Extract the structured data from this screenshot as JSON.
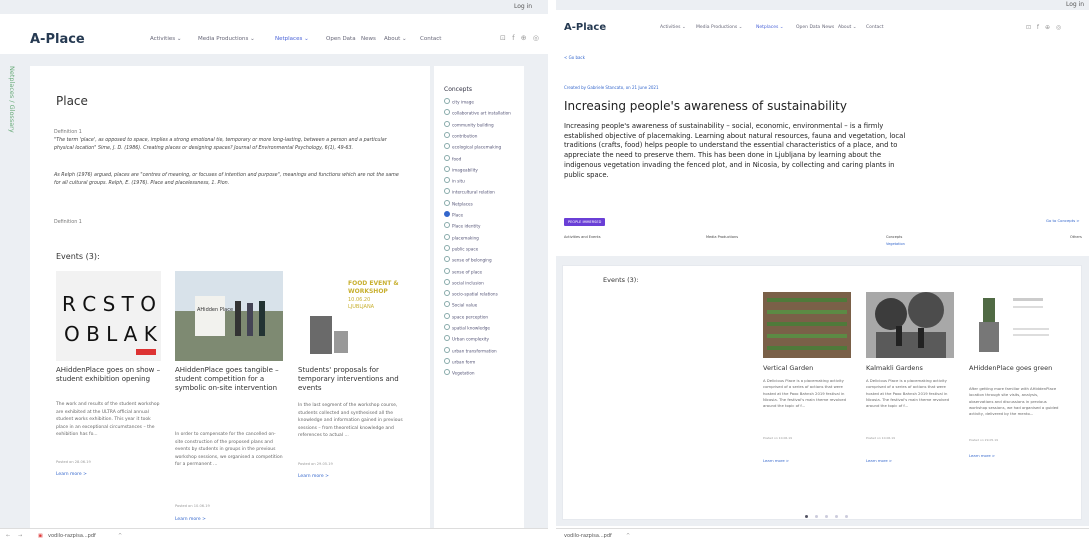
{
  "left": {
    "login": "Log in",
    "logo": "A-Place",
    "nav": [
      "Activities ⌄",
      "Media Productions ⌄",
      "Netplaces ⌄",
      "Open Data",
      "News",
      "About ⌄",
      "Contact"
    ],
    "nav_active_index": 2,
    "social": "⊡ f ⊕ ◎",
    "glossary_label": "Netplaces / Glossary",
    "page_title": "Place",
    "def1_label": "Definition 1",
    "def1_text": "\"The term 'place', as opposed to space, implies a strong emotional tie, temporary or more long-lasting, between a person and a particular physical location\" Sime, J. D. (1986). Creating places or designing spaces? Journal of Environmental Psychology, 6(1), 49-63.",
    "def2_text": "As Relph (1976) argued, places are \"centres of meaning, or focuses of intention and purpose\", meanings and functions which are not the same for all cultural groups. Relph, E. (1976). Place and placelessness, 1. Pion.",
    "def_footer": "Definition 1",
    "concepts_title": "Concepts",
    "concepts": [
      "city image",
      "collaborative art installation",
      "community building",
      "contribution",
      "ecological placemaking",
      "food",
      "imageability",
      "in situ",
      "intercultural relation",
      "Netplaces",
      "Place",
      "Place identity",
      "placemaking",
      "public space",
      "sense of belonging",
      "sense of place",
      "social inclusion",
      "socio-spatial relations",
      "Social value",
      "space perception",
      "spatial knowledge",
      "Urban complexity",
      "urban transformation",
      "urban form",
      "Vegetation"
    ],
    "concept_selected": 10,
    "events_title": "Events (3):",
    "events": [
      {
        "title": "AHiddenPlace goes on show – student exhibition opening",
        "desc": "The work and results of the student workshop are exhibited at the ULTRA official annual student works exhibition. This year it took place in an exceptional circumstances – the exhibition has fo...",
        "date": "Posted on 28.06.19",
        "more": "Learn more >"
      },
      {
        "title": "AHiddenPlace goes tangible – student competition for a symbolic on-site intervention",
        "desc": "In order to compensate for the cancelled on-site construction of the proposed plans and events by students in groups in the previous workshop sessions, we organised a competition for a permanent ...",
        "date": "Posted on 10.06.19",
        "more": "Learn more >"
      },
      {
        "title": "Students' proposals for temporary interventions and events",
        "desc": "In the last segment of the workshop course, students collected and synthesised all the knowledge and information gained in previous sessions – from theoretical knowledge and references to actual ...",
        "date": "Posted on 29.05.19",
        "more": "Learn more >"
      }
    ],
    "ev1_img_text": "R C S T O\nO B L A K",
    "ev2_img_text": "AHidden Place",
    "ev3_img_text": "FOOD EVENT & WORKSHOP 10.06.20 LJUBLJANA",
    "download_file": "vodilo-razpisa...pdf"
  },
  "right": {
    "login": "Log in",
    "logo": "A-Place",
    "nav": [
      "Activities ⌄",
      "Media Productions ⌄",
      "Netplaces ⌄",
      "Open Data",
      "News",
      "About ⌄",
      "Contact"
    ],
    "nav_active_index": 2,
    "social": "⊡ f ⊕ ◎",
    "back": "< Go back",
    "created_by": "Created by Gabriele Stancato, on 21 June 2021",
    "title": "Increasing people's awareness of sustainability",
    "body": "Increasing people's awareness of sustainability – social, economic, environmental – is a firmly established objective of placemaking. Learning about natural resources, fauna and vegetation, local traditions (crafts, food) helps people to understand the essential characteristics of a place, and to appreciate the need to preserve them. This has been done in Ljubljana by learning about the indigenous vegetation invading the fenced plot, and in Nicosia, by collecting and caring plants in public space.",
    "badge": "PEOPLE IMMERSED",
    "go_concepts": "Go to Concepts >",
    "meta": [
      "Activities and Events",
      "Media Productions",
      "Concepts",
      "Others"
    ],
    "meta_sub": "Vegetation",
    "events_title": "Events (3):",
    "events": [
      {
        "title": "Vertical Garden",
        "desc": "A Delicious Place is a placemaking activity comprised of a series of actions that were hosted at the Paxo Bahnsh 2019 festival in Nicosia. The festival's main theme revolved around the topic of f...",
        "date": "Posted on 10.06.19",
        "more": "Learn more >"
      },
      {
        "title": "Kalmakli Gardens",
        "desc": "A Delicious Place is a placemaking activity comprised of a series of actions that were hosted at the Paxo Bahnsh 2019 festival in Nicosia. The festival's main theme revolved around the topic of f...",
        "date": "Posted on 10.06.19",
        "more": "Learn more >"
      },
      {
        "title": "AHiddenPlace goes green",
        "desc": "After getting more familiar with AHiddenPlace location through site visits, analysis, observations and discussions in previous workshop sessions, we had organised a guided activity, delivered by the mento...",
        "date": "Posted on 29.05.19",
        "more": "Learn more >"
      }
    ],
    "download_file": "vodilo-razpisa...pdf"
  }
}
